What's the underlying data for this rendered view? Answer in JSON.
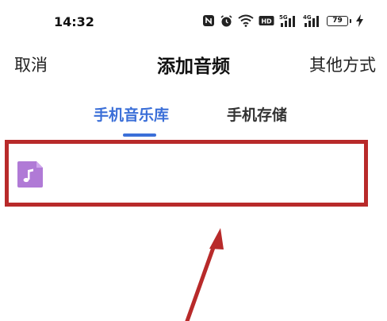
{
  "status_bar": {
    "time": "14:32",
    "battery_level": "79",
    "icons": [
      "nfc-icon",
      "alarm-icon",
      "wifi-icon",
      "hd-icon",
      "5g-signal-icon",
      "4g-signal-icon",
      "battery-icon",
      "charging-icon"
    ]
  },
  "header": {
    "cancel_label": "取消",
    "title": "添加音频",
    "other_label": "其他方式"
  },
  "tabs": [
    {
      "label": "手机音乐库",
      "active": true
    },
    {
      "label": "手机存储",
      "active": false
    }
  ],
  "list": {
    "items": [
      {
        "icon": "music-file-icon",
        "title": ""
      }
    ]
  },
  "colors": {
    "accent": "#3b6fd8",
    "highlight": "#b82a2a",
    "file_icon": "#b07ad6"
  }
}
